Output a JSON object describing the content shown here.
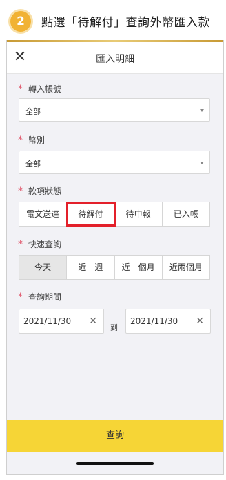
{
  "banner": {
    "step": "2",
    "text": "點選「待解付」查詢外幣匯入款"
  },
  "header": {
    "title": "匯入明細"
  },
  "fields": {
    "account": {
      "label": "轉入帳號",
      "value": "全部"
    },
    "currency": {
      "label": "幣別",
      "value": "全部"
    },
    "status": {
      "label": "款項狀態",
      "options": [
        "電文送達",
        "待解付",
        "待申報",
        "已入帳"
      ],
      "highlighted": "待解付"
    },
    "quick": {
      "label": "快速查詢",
      "options": [
        "今天",
        "近一週",
        "近一個月",
        "近兩個月"
      ],
      "selected": "今天"
    },
    "period": {
      "label": "查詢期間",
      "from": "2021/11/30",
      "to_label": "到",
      "to": "2021/11/30"
    }
  },
  "query_button": "查詢",
  "colors": {
    "accent": "#f6d536",
    "highlight": "#e3202a",
    "required": "#e0566b"
  },
  "icons": {
    "close": "close-icon",
    "caret": "chevron-down-icon",
    "clear": "clear-icon"
  }
}
